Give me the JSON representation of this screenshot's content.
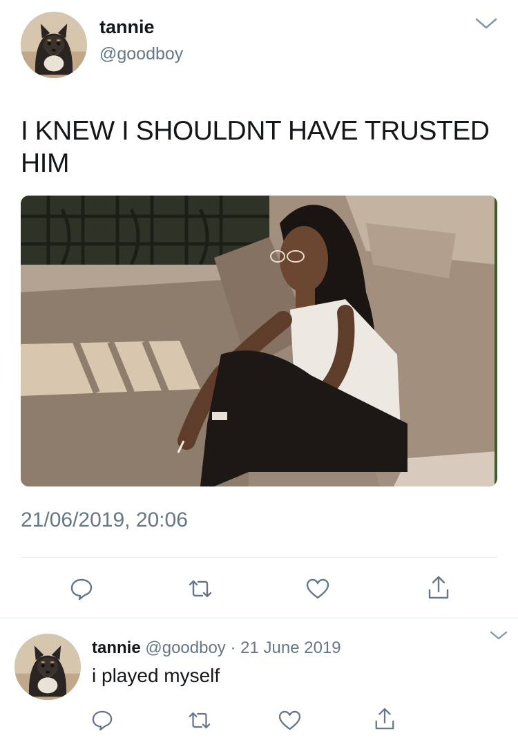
{
  "tweet": {
    "display_name": "tannie",
    "handle": "@goodboy",
    "text": "I KNEW I SHOULDNT HAVE TRUSTED HIM",
    "timestamp": "21/06/2019, 20:06",
    "actions": [
      "reply-icon",
      "retweet-icon",
      "like-icon",
      "share-icon"
    ]
  },
  "reply": {
    "display_name": "tannie",
    "handle": "@goodboy",
    "separator": "·",
    "date": "21 June 2019",
    "text": "i played myself",
    "actions": [
      "reply-icon",
      "retweet-icon",
      "like-icon",
      "share-icon"
    ]
  },
  "colors": {
    "text_primary": "#14171a",
    "text_secondary": "#657786",
    "divider": "#e1e8ed",
    "background": "#ffffff"
  }
}
